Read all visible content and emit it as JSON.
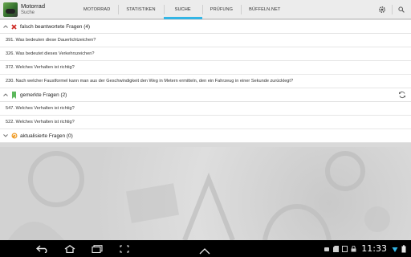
{
  "app": {
    "title": "Motorrad",
    "subtitle": "Suche"
  },
  "tabs": [
    {
      "label": "MOTORRAD"
    },
    {
      "label": "STATISTIKEN"
    },
    {
      "label": "SUCHE"
    },
    {
      "label": "PRÜFUNG"
    },
    {
      "label": "BÜFFELN.NET"
    }
  ],
  "active_tab": "SUCHE",
  "groups": {
    "wrong": {
      "title": "falsch beantwortete Fragen (4)",
      "icon": "red-x-icon",
      "items": [
        "391. Was bedeuten diese Dauerlichtzeichen?",
        "326. Was bedeutet dieses Verkehrszeichen?",
        "372. Welches Verhalten ist richtig?",
        "230. Nach welcher Faustformel kann man aus der Geschwindigkeit den Weg in Metern ermitteln, den ein Fahrzeug in einer Sekunde zurücklegt?"
      ]
    },
    "marked": {
      "title": "gemerkte Fragen (2)",
      "icon": "green-bookmark-icon",
      "items": [
        "547. Welches Verhalten ist richtig?",
        "522. Welches Verhalten ist richtig?"
      ]
    },
    "updated": {
      "title": "aktualisierte Fragen (0)",
      "icon": "orange-update-icon",
      "items": []
    }
  },
  "status": {
    "time": "11:33"
  },
  "colors": {
    "accent": "#33b5e5",
    "wrong": "#d0302b",
    "marked": "#5cb85c",
    "updated": "#f0a030"
  }
}
